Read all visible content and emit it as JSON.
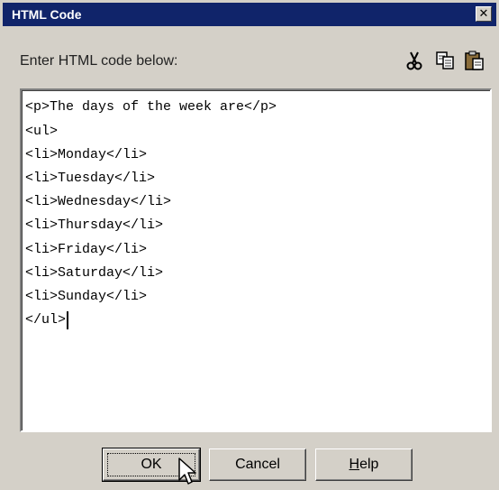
{
  "window": {
    "title": "HTML Code",
    "close_glyph": "✕"
  },
  "instruction": "Enter HTML code below:",
  "toolbar": {
    "icons": [
      "cut-icon",
      "copy-icon",
      "paste-icon"
    ]
  },
  "editor": {
    "lines": [
      "<p>The days of the week are</p>",
      "<ul>",
      "<li>Monday</li>",
      "<li>Tuesday</li>",
      "<li>Wednesday</li>",
      "<li>Thursday</li>",
      "<li>Friday</li>",
      "<li>Saturday</li>",
      "<li>Sunday</li>",
      "</ul>"
    ]
  },
  "buttons": {
    "ok_label": "OK",
    "cancel_label": "Cancel",
    "help_label_underlined": "H",
    "help_label_rest": "elp"
  }
}
